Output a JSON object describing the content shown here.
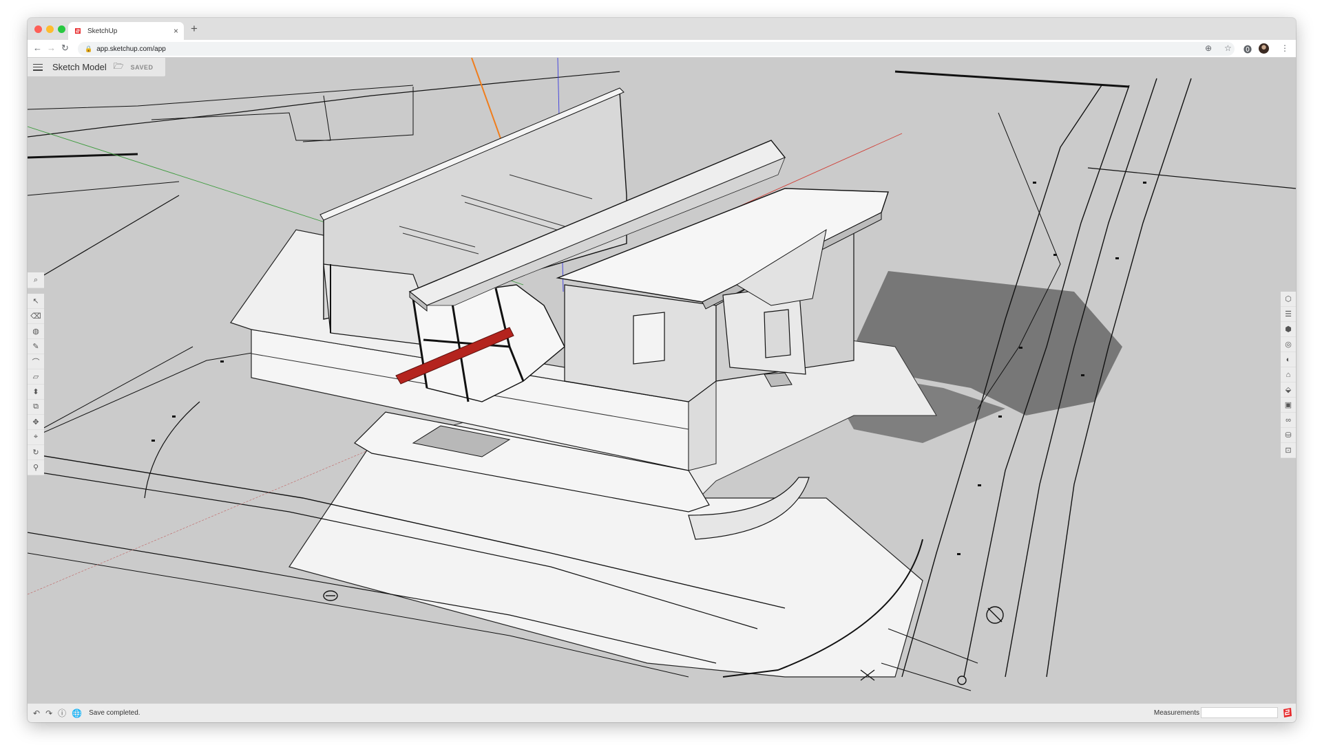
{
  "browser": {
    "tab_title": "SketchUp",
    "tab_close": "×",
    "new_tab": "+",
    "url": "app.sketchup.com/app",
    "nav": {
      "back": "←",
      "forward": "→",
      "reload": "↻"
    }
  },
  "app": {
    "model_name": "Sketch Model",
    "save_state": "SAVED"
  },
  "toolbar_left": [
    {
      "icon": "search-icon",
      "glyph": "⌕"
    },
    {
      "icon": "select-arrow-icon",
      "glyph": "↖"
    },
    {
      "icon": "eraser-icon",
      "glyph": "⌫"
    },
    {
      "icon": "paint-bucket-icon",
      "glyph": "◍"
    },
    {
      "icon": "pencil-icon",
      "glyph": "✎"
    },
    {
      "icon": "arc-icon",
      "glyph": "⌒"
    },
    {
      "icon": "rectangle-icon",
      "glyph": "▱"
    },
    {
      "icon": "push-pull-icon",
      "glyph": "⬍"
    },
    {
      "icon": "offset-icon",
      "glyph": "⧉"
    },
    {
      "icon": "move-icon",
      "glyph": "✥"
    },
    {
      "icon": "tape-measure-icon",
      "glyph": "⌖"
    },
    {
      "icon": "orbit-icon",
      "glyph": "↻"
    },
    {
      "icon": "walk-icon",
      "glyph": "⚲"
    }
  ],
  "toolbar_right": [
    {
      "icon": "entity-info-icon",
      "glyph": "⬡"
    },
    {
      "icon": "instructor-icon",
      "glyph": "☰"
    },
    {
      "icon": "components-icon",
      "glyph": "⬢"
    },
    {
      "icon": "materials-icon",
      "glyph": "◎"
    },
    {
      "icon": "styles-icon",
      "glyph": "◐"
    },
    {
      "icon": "tags-icon",
      "glyph": "⌂"
    },
    {
      "icon": "scenes-icon",
      "glyph": "⬙"
    },
    {
      "icon": "shadows-icon",
      "glyph": "▣"
    },
    {
      "icon": "display-icon",
      "glyph": "∞"
    },
    {
      "icon": "outliner-icon",
      "glyph": "⛁"
    },
    {
      "icon": "solar-icon",
      "glyph": "⊡"
    }
  ],
  "statusbar": {
    "message": "Save completed.",
    "measurements_label": "Measurements",
    "measurements_value": ""
  },
  "colors": {
    "viewport_bg": "#cbcbcb",
    "axis_red": "#d03b32",
    "axis_green": "#3c9b3c",
    "axis_blue": "#3a3adf",
    "guide_orange": "#f07d1c",
    "selected_beam": "#b4241e",
    "logo_red": "#e72b2d"
  }
}
